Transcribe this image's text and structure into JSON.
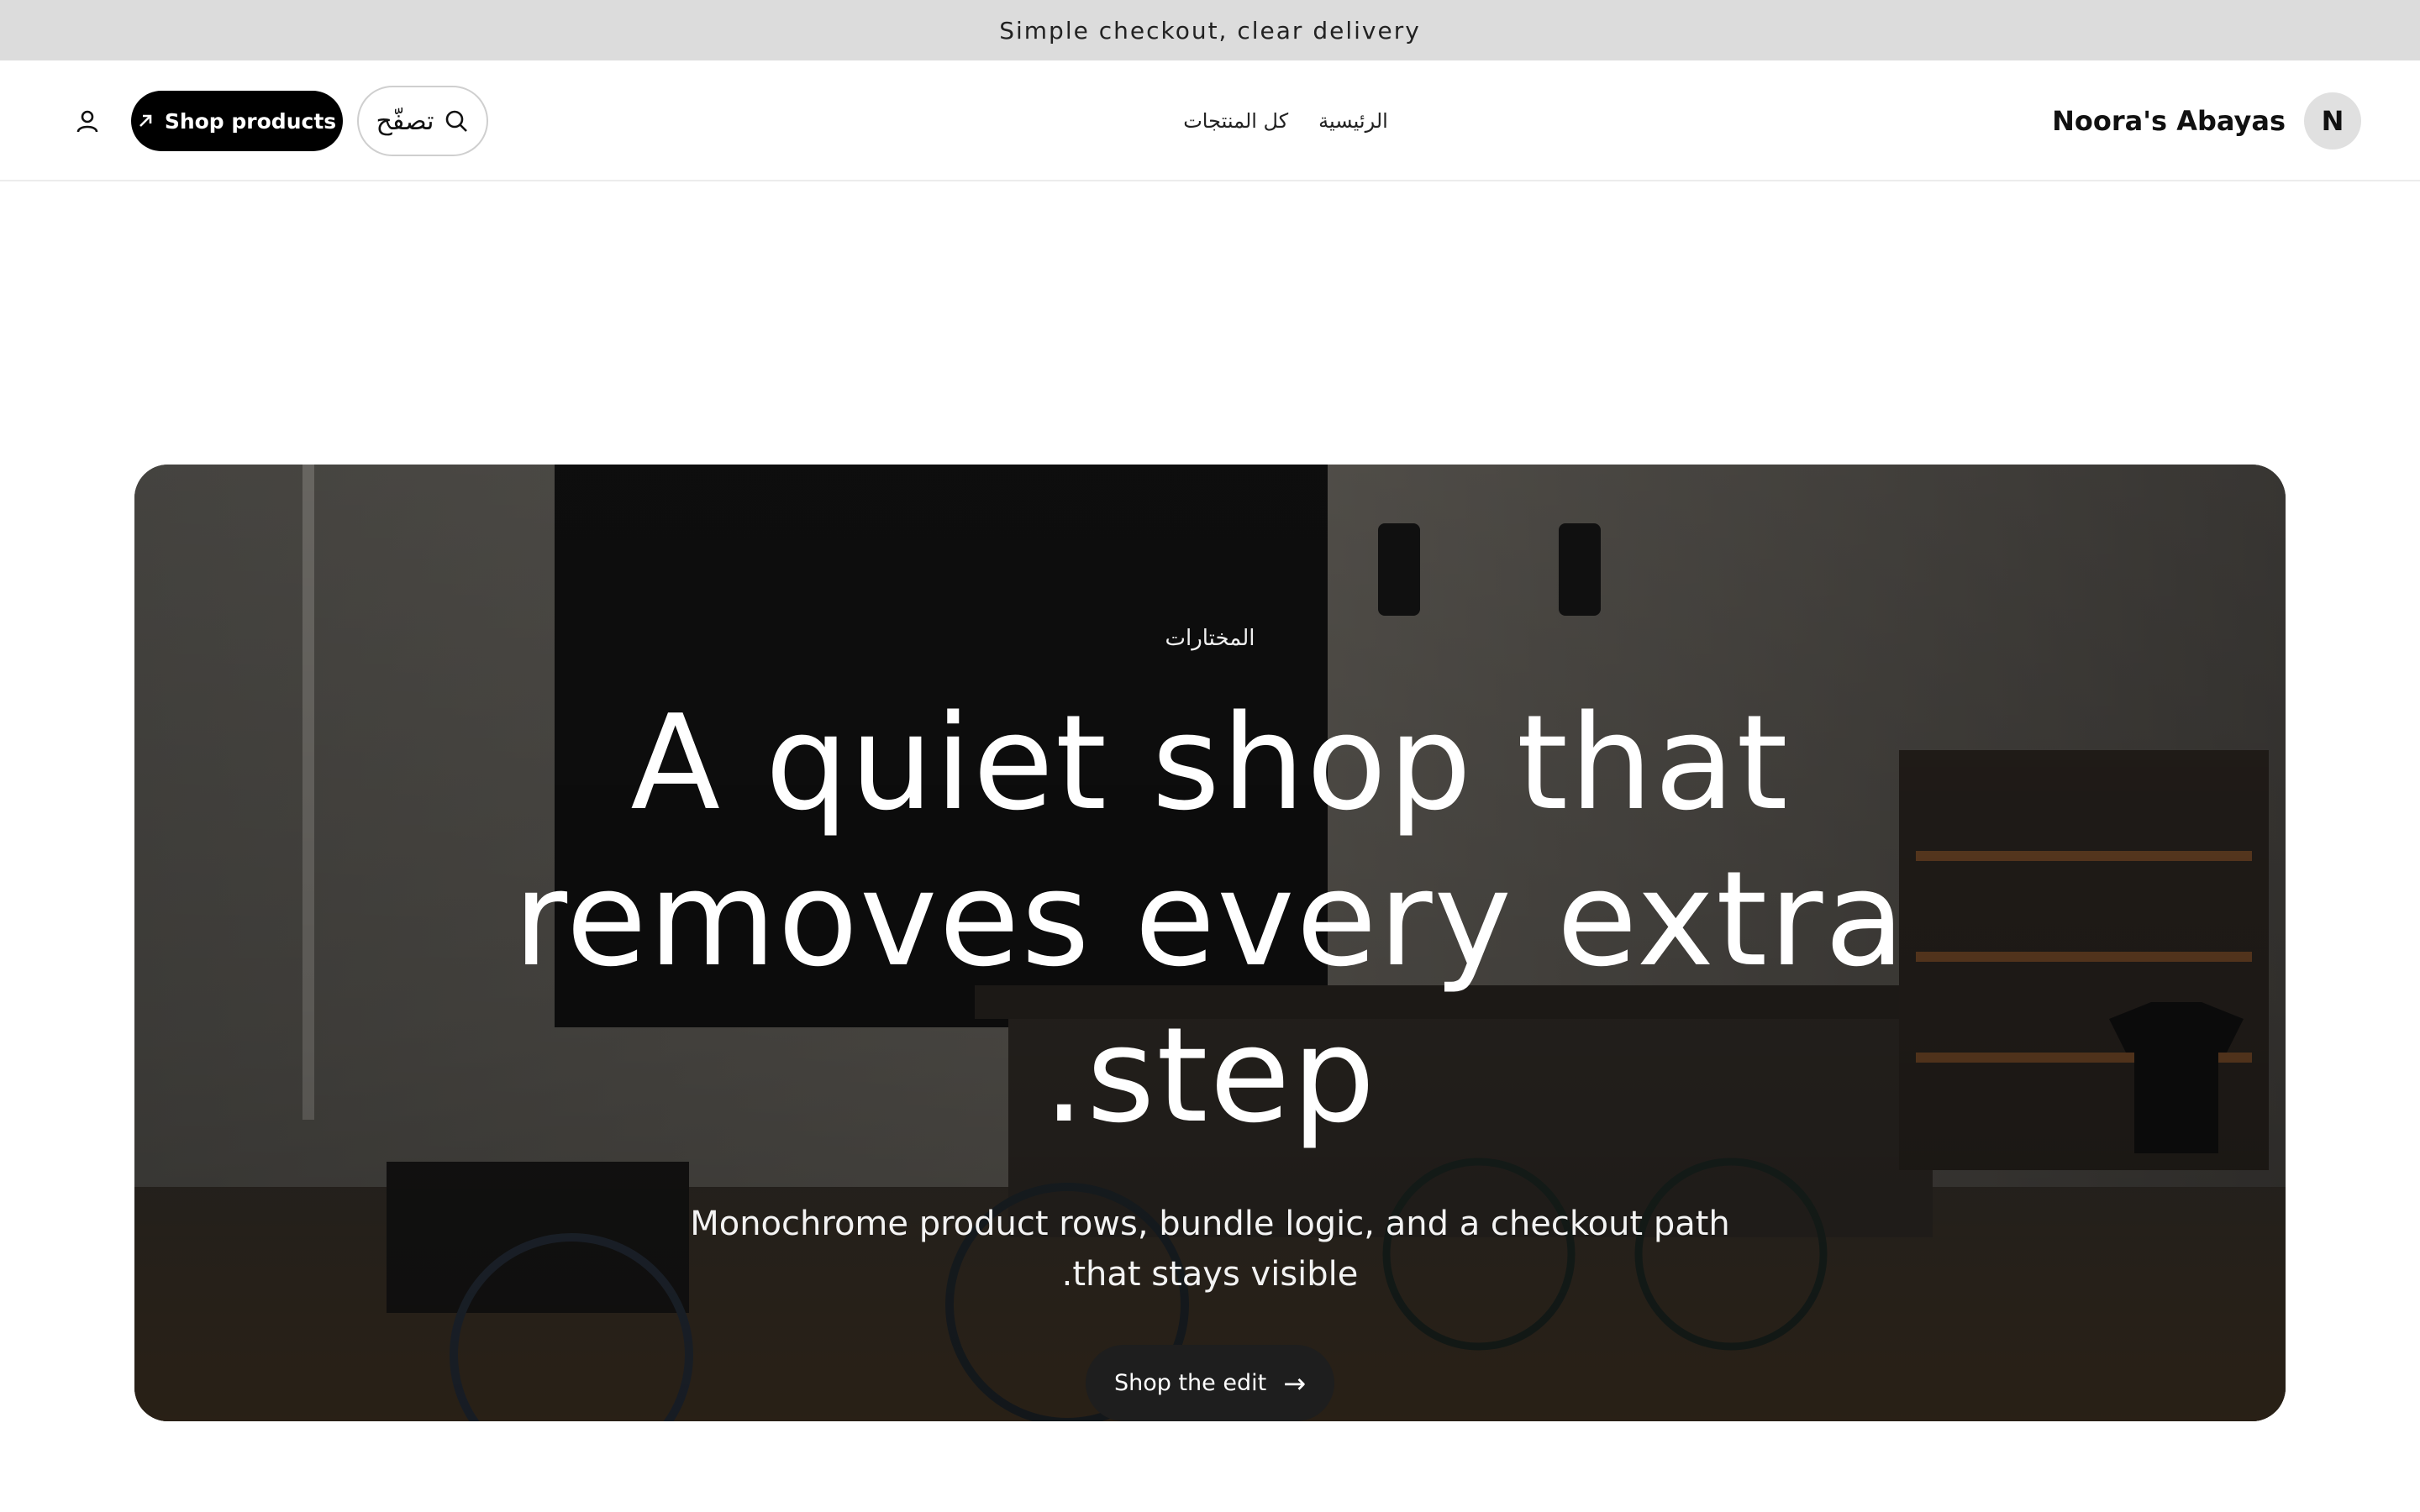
{
  "announcement": {
    "text": "Simple checkout, clear delivery"
  },
  "header": {
    "brand_name": "Noora's Abayas",
    "brand_initial": "N",
    "nav": [
      {
        "label": "الرئيسية"
      },
      {
        "label": "كل المنتجات"
      }
    ],
    "search_label": "تصفّح",
    "shop_button_label": "Shop products",
    "icons": {
      "account": "user-icon",
      "search": "search-icon",
      "shop": "arrow-up-right-icon"
    }
  },
  "hero": {
    "kicker": "المختارات",
    "headline": "A quiet shop that removes every extra step.",
    "subhead": "Monochrome product rows, bundle logic, and a checkout path that stays visible.",
    "cta_label": "Shop the edit",
    "cta_icon": "arrow-right-icon",
    "background_image": "coffee shop interior with menu board and bicycles"
  },
  "colors": {
    "announcement_bg": "#dcdcdc",
    "button_dark": "#000000",
    "cta_bg": "#1e1e1e",
    "avatar_bg": "#e0e0e0"
  }
}
